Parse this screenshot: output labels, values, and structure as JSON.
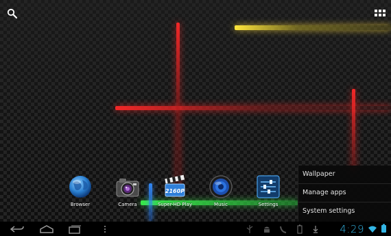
{
  "dock": {
    "items": [
      {
        "label": "Browser",
        "icon": "globe-icon"
      },
      {
        "label": "Camera",
        "icon": "camera-icon"
      },
      {
        "label": "Super-HD Play",
        "icon": "clapperboard-icon"
      },
      {
        "label": "Music",
        "icon": "speaker-icon"
      },
      {
        "label": "Settings",
        "icon": "sliders-icon"
      }
    ]
  },
  "menu": {
    "items": [
      {
        "label": "Wallpaper"
      },
      {
        "label": "Manage apps"
      },
      {
        "label": "System settings"
      }
    ]
  },
  "clapper_text": "2160P",
  "status_bar": {
    "time": "4:29"
  },
  "colors": {
    "clock": "#33b5e5",
    "glow_red": "#ff2828",
    "glow_yellow": "#ffe63c",
    "glow_green": "#3cff50",
    "glow_blue": "#328cff"
  }
}
